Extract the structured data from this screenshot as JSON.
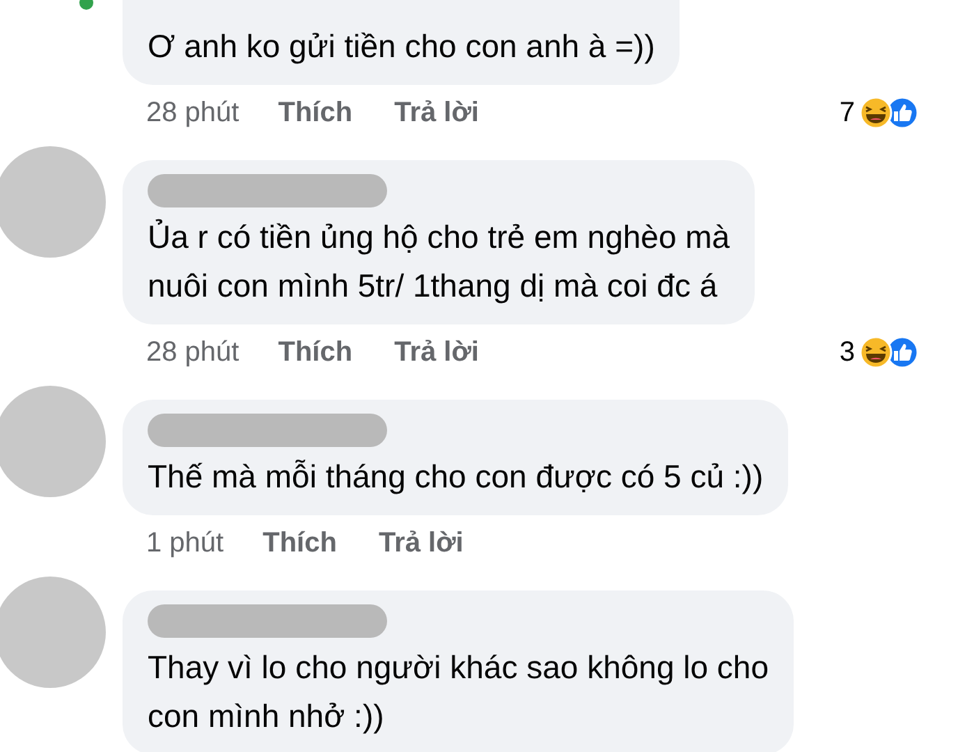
{
  "comments": [
    {
      "cut_off_top": true,
      "online": true,
      "lines": [
        "Ơ anh ko gửi tiền cho con anh à =))"
      ],
      "time": "28 phút",
      "like": "Thích",
      "reply": "Trả lời",
      "reaction_count": "7"
    },
    {
      "cut_off_top": false,
      "online": false,
      "lines": [
        "Ủa r có tiền ủng hộ cho trẻ em nghèo mà",
        "nuôi con mình 5tr/ 1thang dị mà coi đc á"
      ],
      "time": "28 phút",
      "like": "Thích",
      "reply": "Trả lời",
      "reaction_count": "3"
    },
    {
      "cut_off_top": false,
      "online": false,
      "lines": [
        "Thế mà mỗi tháng cho con được có 5 củ :))"
      ],
      "time": "1 phút",
      "like": "Thích",
      "reply": "Trả lời"
    },
    {
      "cut_off_top": false,
      "online": false,
      "lines": [
        "Thay vì lo cho người khác sao không lo cho",
        "con mình nhở :))"
      ]
    }
  ]
}
